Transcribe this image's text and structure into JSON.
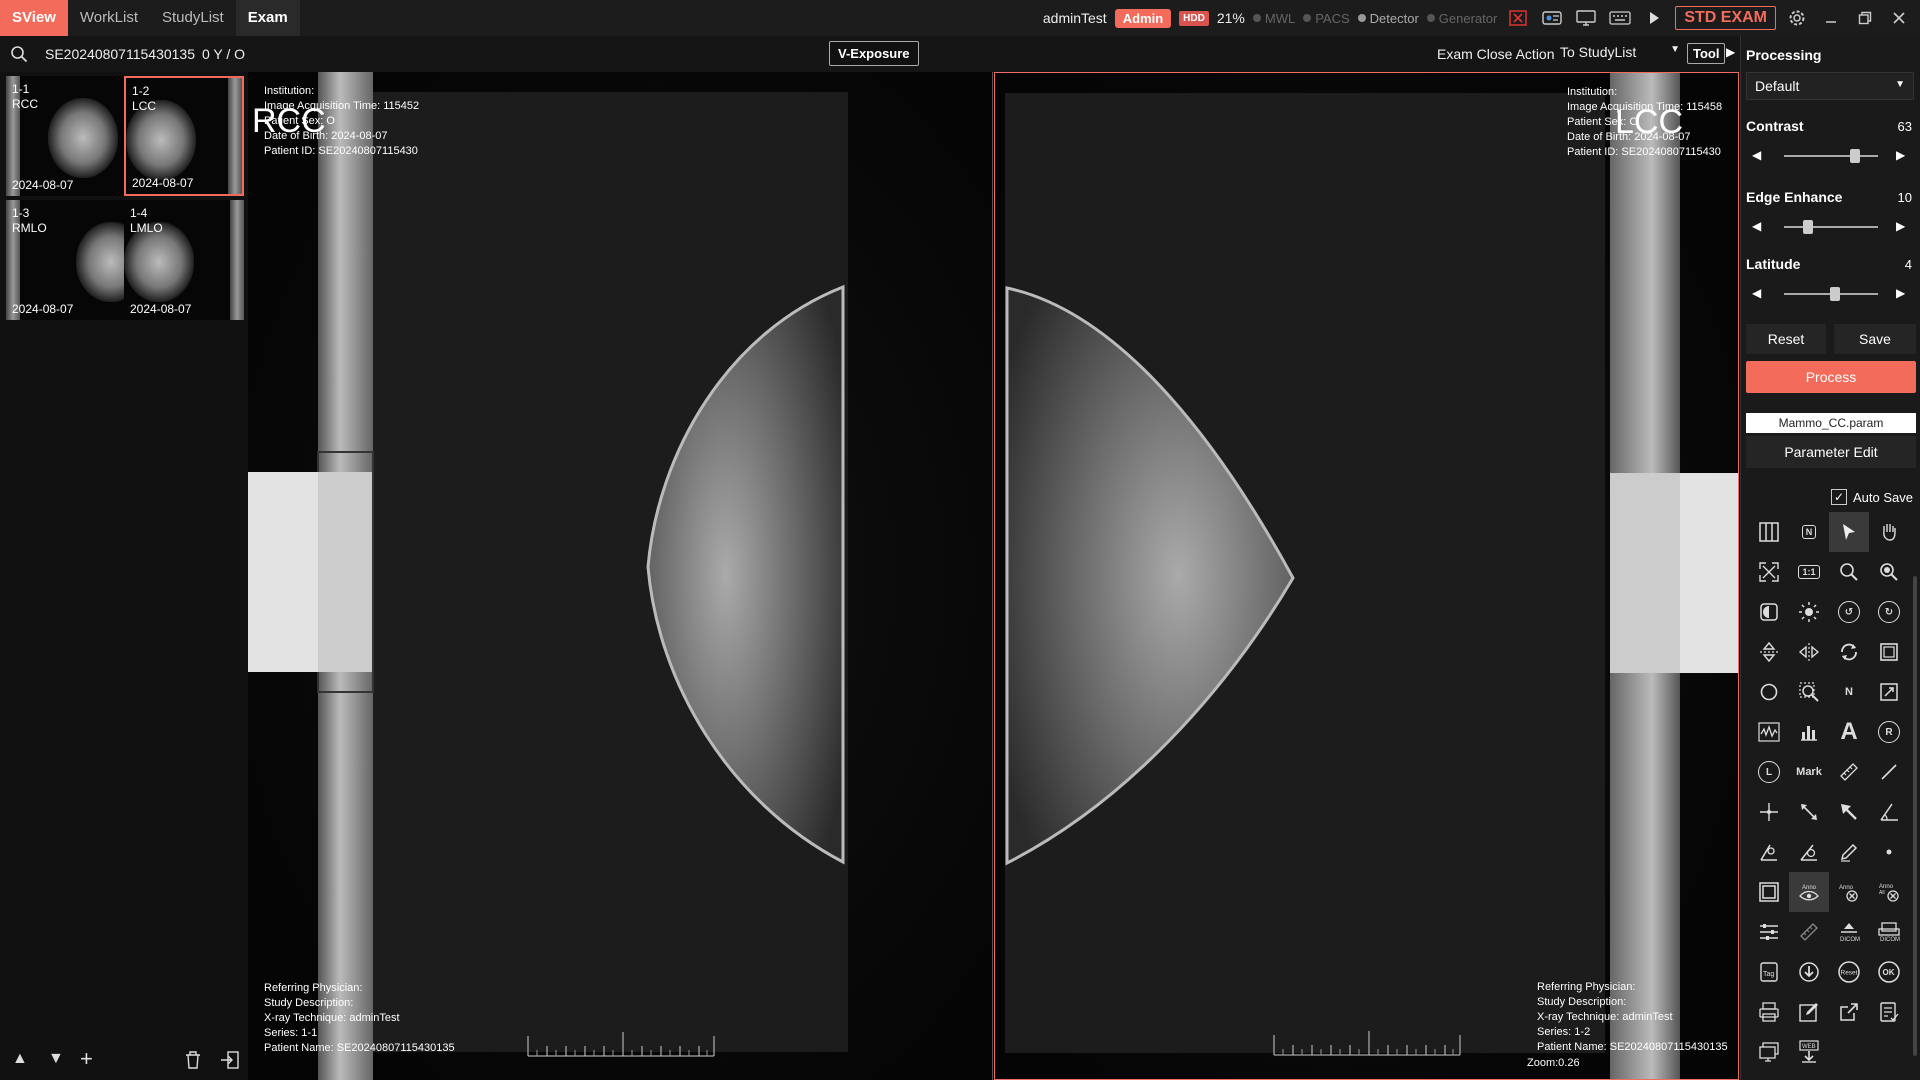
{
  "app": {
    "brand": "SView",
    "tabs": [
      "WorkList",
      "StudyList",
      "Exam"
    ],
    "active_tab": "Exam"
  },
  "topbar": {
    "user": "adminTest",
    "role": "Admin",
    "hdd_label": "HDD",
    "hdd_percent": "21%",
    "statuses": [
      {
        "label": "MWL",
        "on": false
      },
      {
        "label": "PACS",
        "on": false
      },
      {
        "label": "Detector",
        "on": true
      },
      {
        "label": "Generator",
        "on": false
      }
    ],
    "std_exam": "STD EXAM",
    "accent_color": "#f26b5b"
  },
  "subbar": {
    "exam_id": "SE20240807115430135",
    "exam_count": "0 Y / O",
    "v_exposure": "V-Exposure",
    "close_action_label": "Exam Close Action",
    "close_action_value": "To StudyList",
    "tool_label": "Tool"
  },
  "thumbnails": [
    {
      "id": "1-1",
      "view": "RCC",
      "date": "2024-08-07"
    },
    {
      "id": "1-2",
      "view": "LCC",
      "date": "2024-08-07"
    },
    {
      "id": "1-3",
      "view": "RMLO",
      "date": "2024-08-07"
    },
    {
      "id": "1-4",
      "view": "LMLO",
      "date": "2024-08-07"
    }
  ],
  "viewers": {
    "left": {
      "view_label": "RCC",
      "institution": "Institution:",
      "acq_time": "Image Acquisition Time: 115452",
      "patient_sex": "Patient Sex: O",
      "date_of_birth": "Date of Birth: 2024-08-07",
      "patient_id": "Patient ID: SE20240807115430",
      "referring": "Referring Physician:",
      "study_desc": "Study Description:",
      "xray_tech": "X-ray Technique: adminTest",
      "series": "Series: 1-1",
      "patient_name": "Patient Name: SE20240807115430135"
    },
    "right": {
      "view_label": "LCC",
      "institution": "Institution:",
      "acq_time": "Image Acquisition Time: 115458",
      "patient_sex": "Patient Sex: O",
      "date_of_birth": "Date of Birth: 2024-08-07",
      "patient_id": "Patient ID: SE20240807115430",
      "referring": "Referring Physician:",
      "study_desc": "Study Description:",
      "xray_tech": "X-ray Technique: adminTest",
      "series": "Series: 1-2",
      "patient_name": "Patient Name: SE20240807115430135",
      "zoom": "Zoom:0.26"
    }
  },
  "panel": {
    "title": "Processing",
    "preset": "Default",
    "sliders": [
      {
        "label": "Contrast",
        "value": "63"
      },
      {
        "label": "Edge Enhance",
        "value": "10"
      },
      {
        "label": "Latitude",
        "value": "4"
      }
    ],
    "reset": "Reset",
    "save": "Save",
    "process": "Process",
    "param_file": "Mammo_CC.param",
    "param_edit": "Parameter Edit",
    "auto_save": "Auto Save",
    "tool_text": {
      "mark": "Mark",
      "n": "N",
      "one_to_one": "1:1",
      "text_a": "A"
    }
  }
}
